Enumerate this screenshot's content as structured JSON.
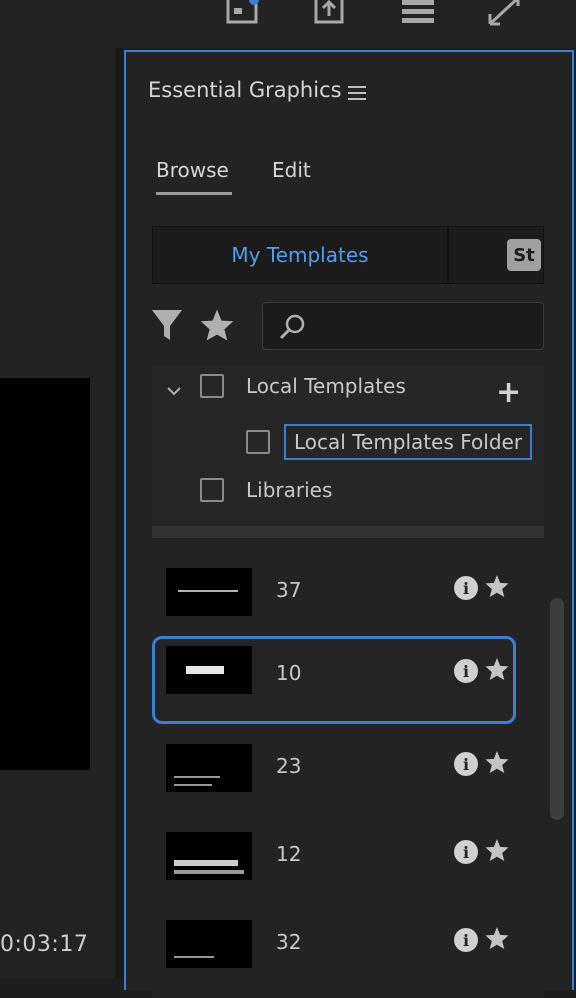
{
  "timecode": "0:03:17",
  "panel": {
    "title": "Essential Graphics",
    "tabs": [
      {
        "label": "Browse",
        "active": true
      },
      {
        "label": "Edit",
        "active": false
      }
    ],
    "segments": {
      "mine": "My Templates",
      "stock": "St"
    },
    "search": {
      "placeholder": ""
    },
    "tree": {
      "local": "Local Templates",
      "folder": "Local Templates Folder",
      "libraries": "Libraries"
    },
    "items": [
      {
        "label": "37",
        "selected": false
      },
      {
        "label": "10",
        "selected": true
      },
      {
        "label": "23",
        "selected": false
      },
      {
        "label": "12",
        "selected": false
      },
      {
        "label": "32",
        "selected": false
      }
    ]
  },
  "colors": {
    "accent": "#3b7fd4",
    "link": "#4f9ff1",
    "panel_bg": "#232323"
  },
  "icons": [
    "hamburger-menu-icon",
    "filter-icon",
    "star-icon",
    "search-icon",
    "chevron-down-icon",
    "plus-icon",
    "info-icon",
    "favorite-star-icon",
    "export-icon",
    "workspace-icon",
    "expand-icon"
  ]
}
